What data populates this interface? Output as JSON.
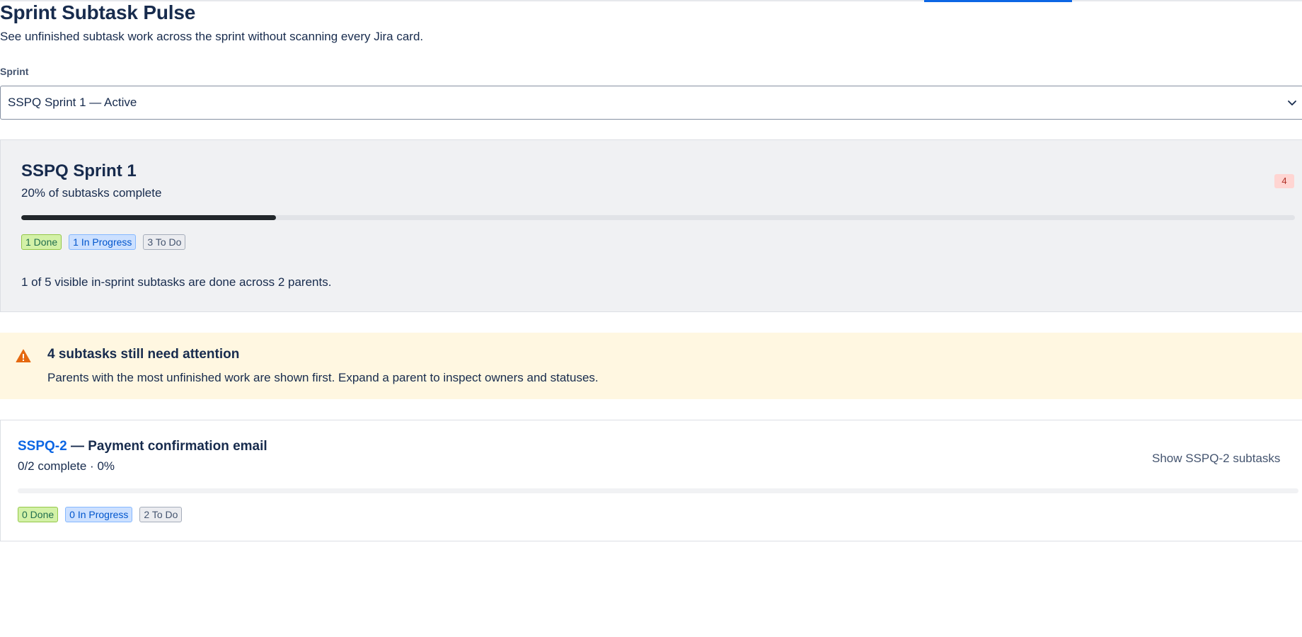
{
  "page": {
    "title": "Sprint Subtask Pulse",
    "subtitle": "See unfinished subtask work across the sprint without scanning every Jira card."
  },
  "sprint_select": {
    "label": "Sprint",
    "value": "SSPQ Sprint 1 — Active",
    "icon": "chevron-down-icon"
  },
  "sprint_summary": {
    "name": "SSPQ Sprint 1",
    "completion_text": "20% of subtasks complete",
    "completion_fraction": 0.2,
    "attention_count": "4",
    "status_pills": {
      "done": "1 Done",
      "in_progress": "1 In Progress",
      "todo": "3 To Do"
    },
    "summary": "1 of 5 visible in-sprint subtasks are done across 2 parents."
  },
  "attention_banner": {
    "icon": "warning-icon",
    "title": "4 subtasks still need attention",
    "description": "Parents with the most unfinished work are shown first. Expand a parent to inspect owners and statuses."
  },
  "parents": [
    {
      "key": "SSPQ-2",
      "title_suffix": " — Payment confirmation email",
      "progress_text": "0/2 complete · 0%",
      "completion_fraction": 0,
      "toggle_label": "Show SSPQ-2 subtasks",
      "status_pills": {
        "done": "0 Done",
        "in_progress": "0 In Progress",
        "todo": "2 To Do"
      }
    }
  ],
  "colors": {
    "link": "#0c66e4",
    "progress_fill": "#22272b",
    "warning_bg": "#fff7e1",
    "warning_icon": "#e56910",
    "badge_bg": "#ffd5d2"
  }
}
